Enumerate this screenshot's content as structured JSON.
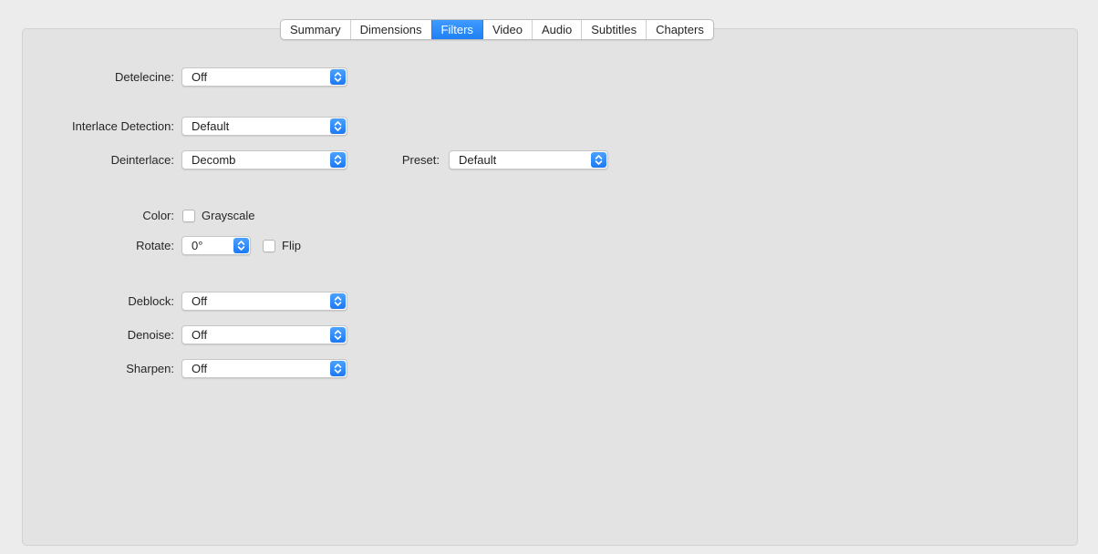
{
  "tabs": [
    {
      "label": "Summary",
      "active": false
    },
    {
      "label": "Dimensions",
      "active": false
    },
    {
      "label": "Filters",
      "active": true
    },
    {
      "label": "Video",
      "active": false
    },
    {
      "label": "Audio",
      "active": false
    },
    {
      "label": "Subtitles",
      "active": false
    },
    {
      "label": "Chapters",
      "active": false
    }
  ],
  "filters": {
    "detelecine": {
      "label": "Detelecine:",
      "value": "Off"
    },
    "interlace_detection": {
      "label": "Interlace Detection:",
      "value": "Default"
    },
    "deinterlace": {
      "label": "Deinterlace:",
      "value": "Decomb"
    },
    "preset": {
      "label": "Preset:",
      "value": "Default"
    },
    "color": {
      "label": "Color:",
      "checkbox_label": "Grayscale",
      "checked": false
    },
    "rotate": {
      "label": "Rotate:",
      "value": "0°",
      "flip_label": "Flip",
      "flip_checked": false
    },
    "deblock": {
      "label": "Deblock:",
      "value": "Off"
    },
    "denoise": {
      "label": "Denoise:",
      "value": "Off"
    },
    "sharpen": {
      "label": "Sharpen:",
      "value": "Off"
    }
  },
  "colors": {
    "accent": "#1f7ff5",
    "panel_bg": "#e3e3e3",
    "window_bg": "#ececec"
  },
  "icons": {
    "popup_stepper": "chevron-up-down-icon"
  }
}
